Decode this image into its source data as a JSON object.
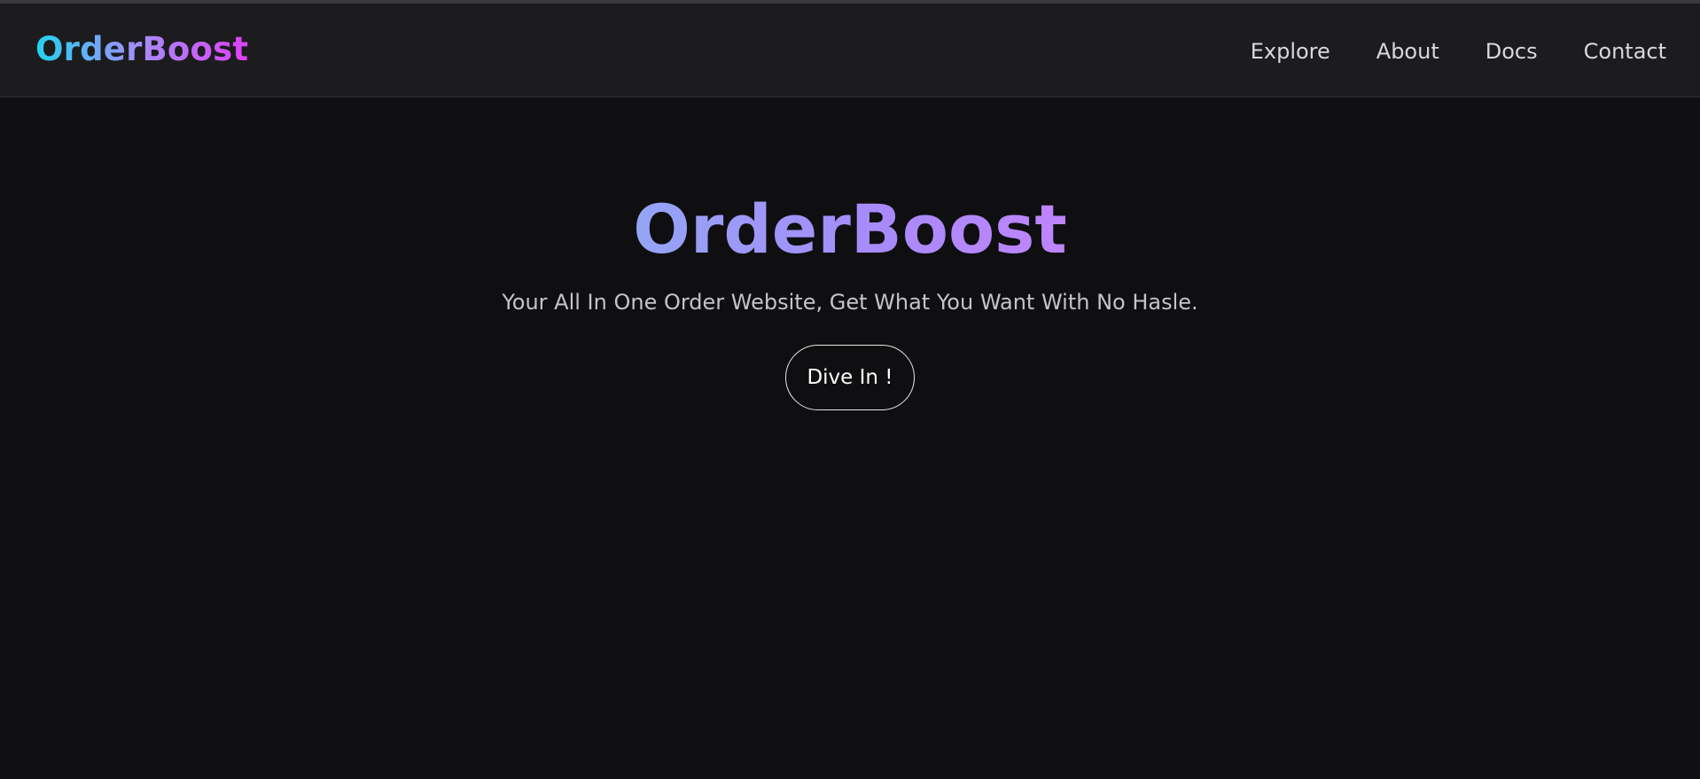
{
  "navbar": {
    "brand": "OrderBoost",
    "links": [
      {
        "label": "Explore"
      },
      {
        "label": "About"
      },
      {
        "label": "Docs"
      },
      {
        "label": "Contact"
      }
    ]
  },
  "hero": {
    "title": "OrderBoost",
    "subtitle": "Your All In One Order Website, Get What You Want With No Hasle.",
    "cta_label": "Dive In !"
  },
  "colors": {
    "background": "#0f0f11",
    "navbar_background": "#1c1c1e",
    "brand_gradient": [
      "#22d3ee",
      "#a78bfa",
      "#e040fb"
    ],
    "title_gradient": [
      "#93a5f5",
      "#a78bfa",
      "#c084fc"
    ]
  }
}
